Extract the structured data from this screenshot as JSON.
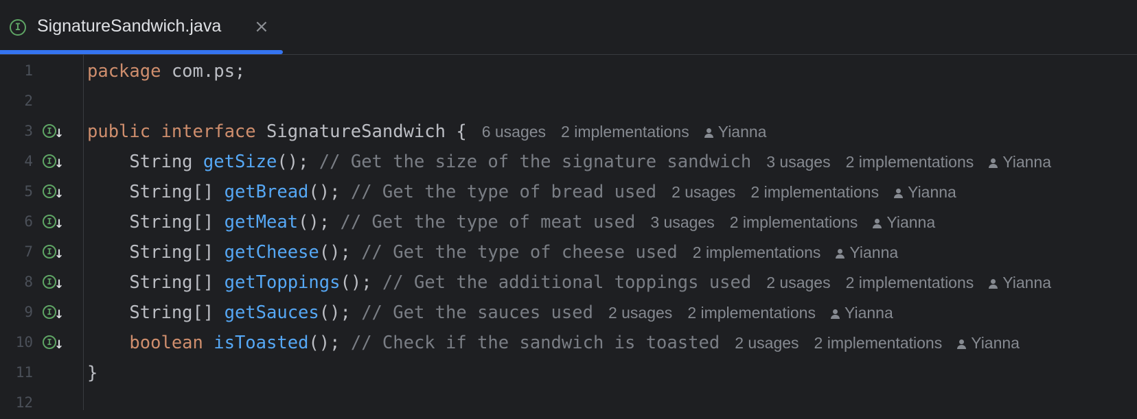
{
  "tab": {
    "label": "SignatureSandwich.java",
    "icon": "interface-icon",
    "close": "×"
  },
  "colors": {
    "background": "#1e1f22",
    "keyword": "#cf8e6d",
    "method": "#56a8f5",
    "comment": "#7a7e85",
    "accent": "#3574f0"
  },
  "lines": [
    {
      "n": "1",
      "tokens": [
        {
          "t": "kw",
          "v": "package"
        },
        {
          "t": "tx",
          "v": " com.ps;"
        }
      ]
    },
    {
      "n": "2",
      "tokens": []
    },
    {
      "n": "3",
      "icon": true,
      "tokens": [
        {
          "t": "kw",
          "v": "public interface"
        },
        {
          "t": "tx",
          "v": " SignatureSandwich {"
        }
      ],
      "hints": {
        "usages": "6 usages",
        "impl": "2 implementations",
        "author": "Yianna"
      }
    },
    {
      "n": "4",
      "icon": true,
      "tokens": [
        {
          "t": "tx",
          "v": "    String "
        },
        {
          "t": "fn",
          "v": "getSize"
        },
        {
          "t": "tx",
          "v": "(); "
        },
        {
          "t": "cm",
          "v": "// Get the size of the signature sandwich"
        }
      ],
      "hints": {
        "usages": "3 usages",
        "impl": "2 implementations",
        "author": "Yianna"
      }
    },
    {
      "n": "5",
      "icon": true,
      "tokens": [
        {
          "t": "tx",
          "v": "    String[] "
        },
        {
          "t": "fn",
          "v": "getBread"
        },
        {
          "t": "tx",
          "v": "(); "
        },
        {
          "t": "cm",
          "v": "// Get the type of bread used"
        }
      ],
      "hints": {
        "usages": "2 usages",
        "impl": "2 implementations",
        "author": "Yianna"
      }
    },
    {
      "n": "6",
      "icon": true,
      "tokens": [
        {
          "t": "tx",
          "v": "    String[] "
        },
        {
          "t": "fn",
          "v": "getMeat"
        },
        {
          "t": "tx",
          "v": "(); "
        },
        {
          "t": "cm",
          "v": "// Get the type of meat used"
        }
      ],
      "hints": {
        "usages": "3 usages",
        "impl": "2 implementations",
        "author": "Yianna"
      }
    },
    {
      "n": "7",
      "icon": true,
      "tokens": [
        {
          "t": "tx",
          "v": "    String[] "
        },
        {
          "t": "fn",
          "v": "getCheese"
        },
        {
          "t": "tx",
          "v": "(); "
        },
        {
          "t": "cm",
          "v": "// Get the type of cheese used"
        }
      ],
      "hints": {
        "impl": "2 implementations",
        "author": "Yianna"
      }
    },
    {
      "n": "8",
      "icon": true,
      "tokens": [
        {
          "t": "tx",
          "v": "    String[] "
        },
        {
          "t": "fn",
          "v": "getToppings"
        },
        {
          "t": "tx",
          "v": "(); "
        },
        {
          "t": "cm",
          "v": "// Get the additional toppings used"
        }
      ],
      "hints": {
        "usages": "2 usages",
        "impl": "2 implementations",
        "author": "Yianna"
      }
    },
    {
      "n": "9",
      "icon": true,
      "tokens": [
        {
          "t": "tx",
          "v": "    String[] "
        },
        {
          "t": "fn",
          "v": "getSauces"
        },
        {
          "t": "tx",
          "v": "(); "
        },
        {
          "t": "cm",
          "v": "// Get the sauces used"
        }
      ],
      "hints": {
        "usages": "2 usages",
        "impl": "2 implementations",
        "author": "Yianna"
      }
    },
    {
      "n": "10",
      "icon": true,
      "tokens": [
        {
          "t": "tx",
          "v": "    "
        },
        {
          "t": "kw",
          "v": "boolean"
        },
        {
          "t": "tx",
          "v": " "
        },
        {
          "t": "fn",
          "v": "isToasted"
        },
        {
          "t": "tx",
          "v": "(); "
        },
        {
          "t": "cm",
          "v": "// Check if the sandwich is toasted"
        }
      ],
      "hints": {
        "usages": "2 usages",
        "impl": "2 implementations",
        "author": "Yianna"
      }
    },
    {
      "n": "11",
      "tokens": [
        {
          "t": "tx",
          "v": "}"
        }
      ]
    },
    {
      "n": "12",
      "tokens": []
    }
  ]
}
